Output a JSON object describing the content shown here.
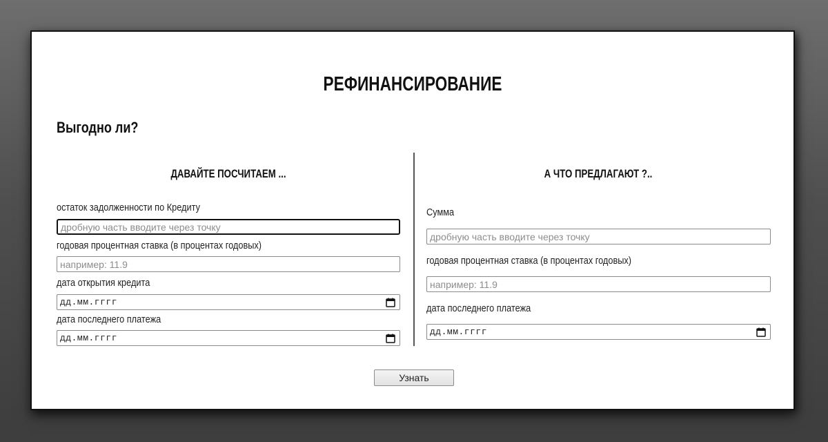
{
  "page": {
    "title": "РЕФИНАНСИРОВАНИЕ",
    "subtitle": "Выгодно ли?"
  },
  "left": {
    "heading": "ДАВАЙТЕ ПОСЧИТАЕМ ...",
    "debt_label": "остаток задолженности по Кредиту",
    "debt_placeholder": "дробную часть вводите через точку",
    "rate_label": "годовая процентная ставка (в процентах годовых)",
    "rate_placeholder": "например: 11.9",
    "open_date_label": "дата открытия кредита",
    "open_date_value": "дд.мм.гггг",
    "last_payment_label": "дата последнего платежа",
    "last_payment_value": "дд.мм.гггг"
  },
  "right": {
    "heading": "А ЧТО ПРЕДЛАГАЮТ ?..",
    "sum_label": "Сумма",
    "sum_placeholder": "дробную часть вводите через точку",
    "rate_label": "годовая процентная ставка (в процентах годовых)",
    "rate_placeholder": "например: 11.9",
    "last_payment_label": "дата последнего платежа",
    "last_payment_value": "дд.мм.гггг"
  },
  "submit": {
    "label": "Узнать"
  },
  "icons": {
    "date_picker": "calendar-icon"
  }
}
